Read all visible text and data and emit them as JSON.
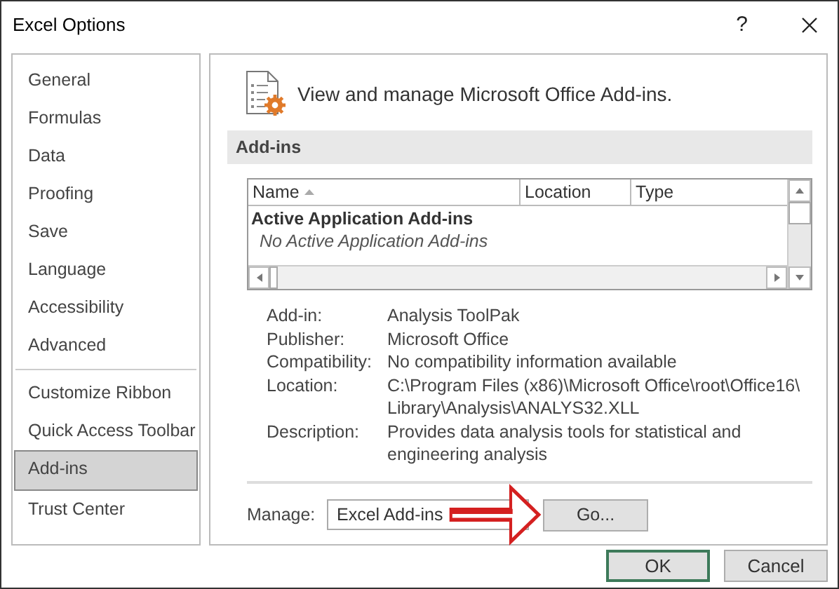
{
  "window": {
    "title": "Excel Options",
    "help": "?"
  },
  "sidebar": {
    "sections": [
      [
        {
          "label": "General",
          "selected": false
        },
        {
          "label": "Formulas",
          "selected": false
        },
        {
          "label": "Data",
          "selected": false
        },
        {
          "label": "Proofing",
          "selected": false
        },
        {
          "label": "Save",
          "selected": false
        },
        {
          "label": "Language",
          "selected": false
        },
        {
          "label": "Accessibility",
          "selected": false
        },
        {
          "label": "Advanced",
          "selected": false
        }
      ],
      [
        {
          "label": "Customize Ribbon",
          "selected": false
        },
        {
          "label": "Quick Access Toolbar",
          "selected": false
        },
        {
          "label": "Add-ins",
          "selected": true
        },
        {
          "label": "Trust Center",
          "selected": false
        }
      ]
    ]
  },
  "header": {
    "text": "View and manage Microsoft Office Add-ins."
  },
  "section_title": "Add-ins",
  "addins_table": {
    "columns": [
      {
        "label": "Name",
        "sorted": true
      },
      {
        "label": "Location",
        "sorted": false
      },
      {
        "label": "Type",
        "sorted": false
      }
    ],
    "groups": [
      {
        "title": "Active Application Add-ins",
        "empty_text": "No Active Application Add-ins"
      }
    ]
  },
  "details": [
    {
      "label": "Add-in:",
      "lines": [
        "Analysis ToolPak"
      ]
    },
    {
      "label": "Publisher:",
      "lines": [
        "Microsoft Office"
      ]
    },
    {
      "label": "Compatibility:",
      "lines": [
        "No compatibility information available"
      ]
    },
    {
      "label": "Location:",
      "lines": [
        "C:\\Program Files (x86)\\Microsoft Office\\root\\Office16\\",
        "Library\\Analysis\\ANALYS32.XLL"
      ]
    },
    {
      "label": "Description:",
      "lines": [
        "Provides data analysis tools for statistical and",
        "engineering analysis"
      ]
    }
  ],
  "manage": {
    "label": "Manage:",
    "value": "Excel Add-ins",
    "button": "Go..."
  },
  "buttons": [
    {
      "label": "OK",
      "default": true
    },
    {
      "label": "Cancel",
      "default": false
    }
  ]
}
